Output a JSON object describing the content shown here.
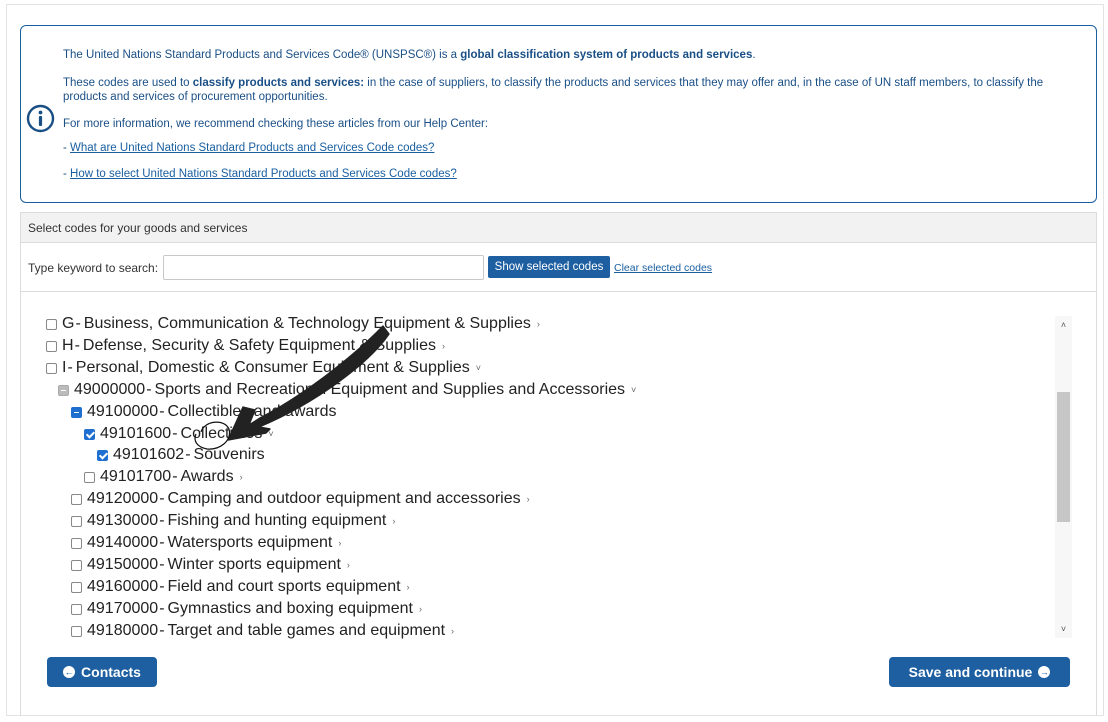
{
  "info": {
    "line1_prefix": "The United Nations Standard Products and Services Code® (UNSPSC®) is a ",
    "line1_bold": "global classification system of products and services",
    "line1_suffix": ".",
    "line2_prefix": "These codes are used to ",
    "line2_bold": "classify products and services:",
    "line2_suffix": " in the case of suppliers, to classify the products and services that they may offer and, in the case of UN staff members, to classify the products and services of procurement opportunities.",
    "line3": "For more information, we recommend checking these articles from our Help Center:",
    "link1_prefix": "- ",
    "link1": "What are United Nations Standard Products and Services Code codes?",
    "link2_prefix": "- ",
    "link2": "How to select United Nations Standard Products and Services Code codes?",
    "icon": "info-icon"
  },
  "panel": {
    "title": "Select codes for your goods and services",
    "search_label": "Type keyword to search:",
    "search_value": "",
    "show_selected": "Show selected codes",
    "clear_selected": "Clear selected codes"
  },
  "tree": [
    {
      "code": "G",
      "label": "Business, Communication & Technology Equipment & Supplies",
      "state": "unchecked",
      "chevron": ">"
    },
    {
      "code": "H",
      "label": "Defense, Security & Safety Equipment & Supplies",
      "state": "unchecked",
      "chevron": ">"
    },
    {
      "code": "I",
      "label": "Personal, Domestic & Consumer Equipment & Supplies",
      "state": "unchecked",
      "chevron": "v"
    },
    {
      "code": "49000000",
      "label": "Sports and Recreational Equipment and Supplies and Accessories",
      "state": "partial-grey",
      "chevron": "v"
    },
    {
      "code": "49100000",
      "label": "Collectibles and awards",
      "state": "partial-blue",
      "chevron": ""
    },
    {
      "code": "49101600",
      "label": "Collectibles",
      "state": "checked",
      "chevron": "v"
    },
    {
      "code": "49101602",
      "label": "Souvenirs",
      "state": "checked",
      "chevron": ""
    },
    {
      "code": "49101700",
      "label": "Awards",
      "state": "unchecked",
      "chevron": ">"
    },
    {
      "code": "49120000",
      "label": "Camping and outdoor equipment and accessories",
      "state": "unchecked",
      "chevron": ">"
    },
    {
      "code": "49130000",
      "label": "Fishing and hunting equipment",
      "state": "unchecked",
      "chevron": ">"
    },
    {
      "code": "49140000",
      "label": "Watersports equipment",
      "state": "unchecked",
      "chevron": ">"
    },
    {
      "code": "49150000",
      "label": "Winter sports equipment",
      "state": "unchecked",
      "chevron": ">"
    },
    {
      "code": "49160000",
      "label": "Field and court sports equipment",
      "state": "unchecked",
      "chevron": ">"
    },
    {
      "code": "49170000",
      "label": "Gymnastics and boxing equipment",
      "state": "unchecked",
      "chevron": ">"
    },
    {
      "code": "49180000",
      "label": "Target and table games and equipment",
      "state": "unchecked",
      "chevron": ">"
    }
  ],
  "buttons": {
    "back_label": "Contacts",
    "back_icon": "arrow-left-circle-icon",
    "save_label": "Save and continue",
    "save_icon": "arrow-right-circle-icon"
  },
  "colors": {
    "accent": "#1d5fa0",
    "checkbox_checked": "#1f6fd1",
    "info_border": "#1a5fa0"
  }
}
